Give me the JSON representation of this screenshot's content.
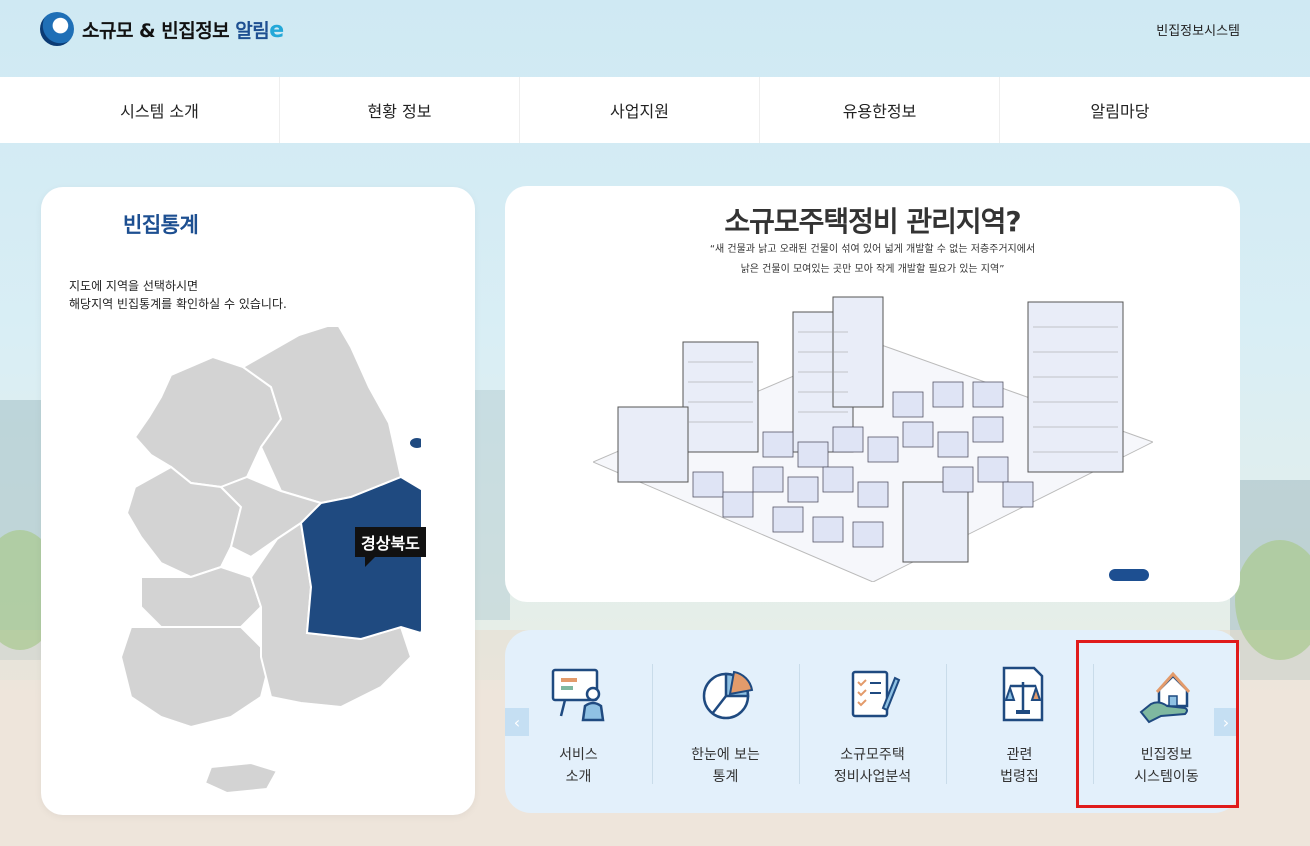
{
  "header": {
    "logo_main": "소규모 & 빈집정보 ",
    "logo_accent": "알림",
    "logo_e": "e",
    "top_link": "빈집정보시스템"
  },
  "nav": {
    "items": [
      "시스템 소개",
      "현황 정보",
      "사업지원",
      "유용한정보",
      "알림마당"
    ]
  },
  "stats_card": {
    "title": "빈집통계",
    "desc_line1": "지도에 지역을 선택하시면",
    "desc_line2": "해당지역 빈집통계를 확인하실 수 있습니다.",
    "selected_region": "경상북도"
  },
  "banner": {
    "title": "소규모주택정비 관리지역?",
    "sub_line1": "“새 건물과 낡고 오래된 건물이 섞여 있어 넓게 개발할 수 없는 저층주거지에서",
    "sub_line2": "낡은 건물이 모여있는 곳만 모아 작게 개발할 필요가 있는 지역”"
  },
  "quick_menu": {
    "items": [
      {
        "label": "서비스\n소개",
        "icon": "presentation-icon"
      },
      {
        "label": "한눈에 보는\n통계",
        "icon": "pie-chart-icon"
      },
      {
        "label": "소규모주택\n정비사업분석",
        "icon": "checklist-icon"
      },
      {
        "label": "관련\n법령집",
        "icon": "law-scale-icon"
      },
      {
        "label": "빈집정보\n시스템이동",
        "icon": "house-hand-icon"
      }
    ],
    "prev": "‹",
    "next": "›"
  },
  "colors": {
    "brand": "#1d4f91",
    "map_gray": "#d3d3d3",
    "highlight": "#e01b1b"
  }
}
